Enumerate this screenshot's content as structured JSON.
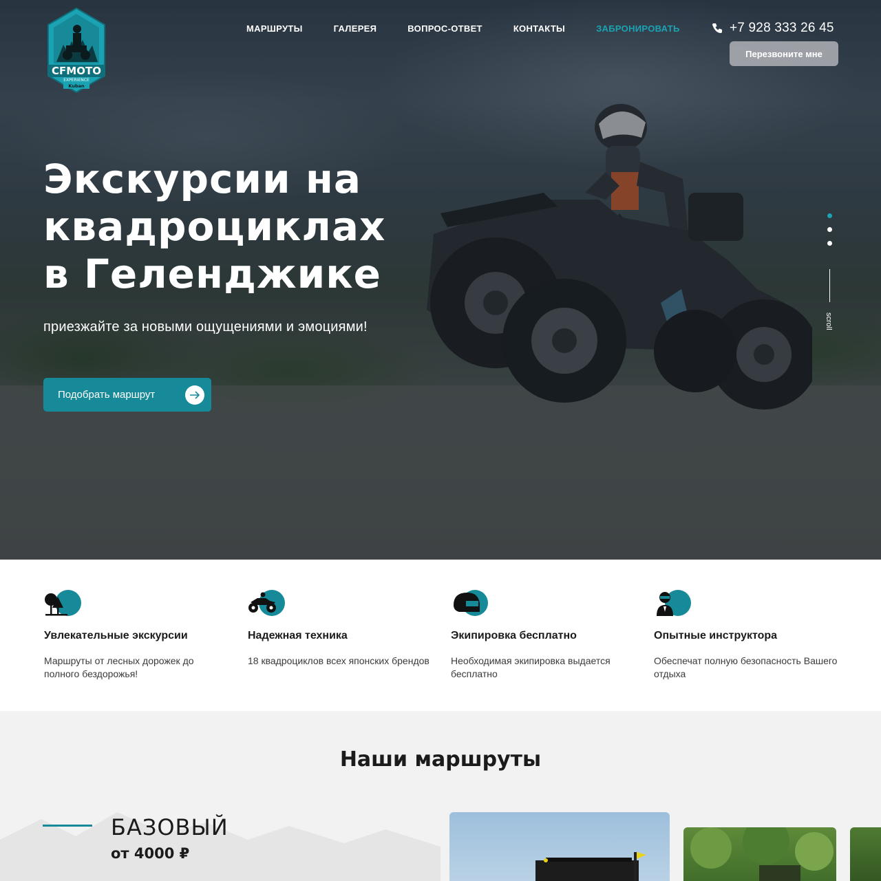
{
  "brand": {
    "name": "CFMOTO",
    "sub1": "EXPERIENCE",
    "sub2": "Kuban"
  },
  "nav": {
    "items": [
      {
        "label": "МАРШРУТЫ"
      },
      {
        "label": "ГАЛЕРЕЯ"
      },
      {
        "label": "ВОПРОС-ОТВЕТ"
      },
      {
        "label": "КОНТАКТЫ"
      },
      {
        "label": "ЗАБРОНИРОВАТЬ"
      }
    ]
  },
  "contact": {
    "phone": "+7 928 333 26 45",
    "callback_label": "Перезвоните мне"
  },
  "hero": {
    "title_line1": "Экскурсии на",
    "title_line2": "квадроциклах",
    "title_line3": "в Геленджике",
    "subtitle": "приезжайте за новыми ощущениями и эмоциями!",
    "cta_label": "Подобрать маршрут",
    "scroll_label": "scroll"
  },
  "features": [
    {
      "icon": "tree-icon",
      "title": "Увлекательные экскурсии",
      "text": "Маршруты от лесных дорожек до полного бездорожья!"
    },
    {
      "icon": "quad-bike-icon",
      "title": "Надежная техника",
      "text": "18 квадроциклов всех японских брендов"
    },
    {
      "icon": "helmet-icon",
      "title": "Экипировка бесплатно",
      "text": "Необходимая экипировка выдается бесплатно"
    },
    {
      "icon": "instructor-icon",
      "title": "Опытные инструктора",
      "text": "Обеспечат полную безопасность Вашего отдыха"
    }
  ],
  "routes": {
    "heading": "Наши маршруты",
    "first": {
      "name": "БАЗОВЫЙ",
      "price": "от 4000 ₽"
    }
  },
  "colors": {
    "accent": "#178a99",
    "accent_light": "#1ba3b3"
  }
}
